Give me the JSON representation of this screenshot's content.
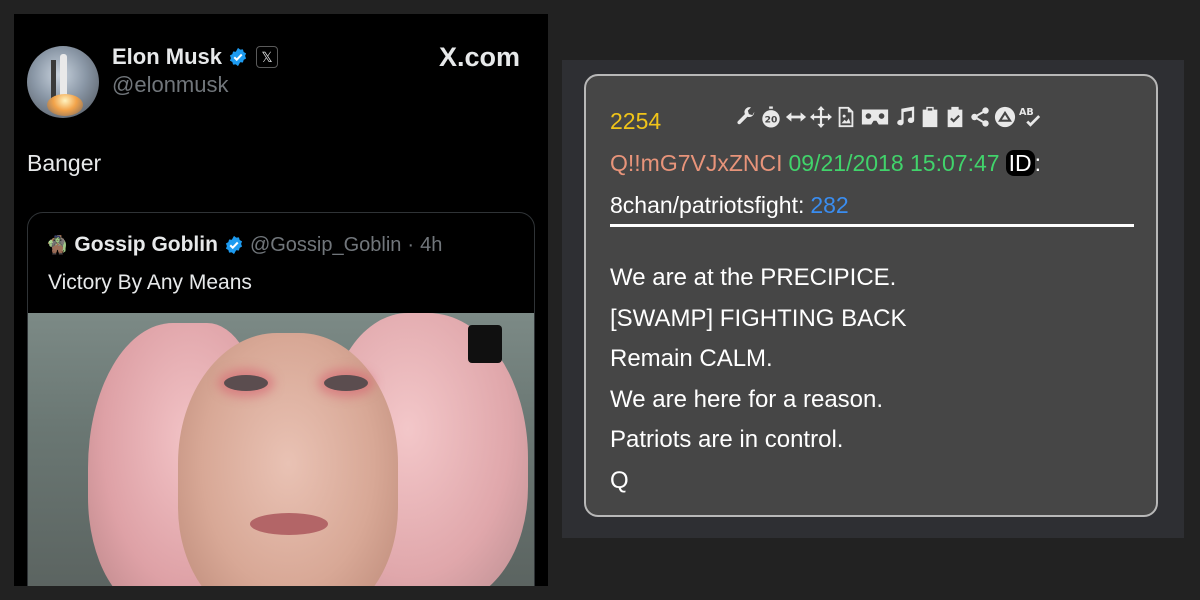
{
  "tweet": {
    "display_name": "Elon Musk",
    "handle": "@elonmusk",
    "site_label": "X.com",
    "x_badge": "𝕏",
    "text": "Banger",
    "colors": {
      "background": "#000000",
      "text": "#e7e9ea",
      "muted": "#71767b",
      "verified": "#1d9bf0"
    },
    "quote": {
      "avatar_emoji": "🧌",
      "display_name": "Gossip Goblin",
      "handle": "@Gossip_Goblin",
      "separator": "·",
      "time": "4h",
      "text": "Victory By Any Means"
    }
  },
  "post": {
    "number": "2254",
    "tripcode": "Q!!mG7VJxZNCI",
    "datetime": "09/21/2018 15:07:47",
    "id_label": "ID",
    "id_colon": ":",
    "board": "8chan/patriotsfight:",
    "board_number": "282",
    "toolbar_icons": [
      "wrench-icon",
      "timer-20-icon",
      "horizontal-arrows-icon",
      "move-arrows-icon",
      "image-file-icon",
      "vr-headset-icon",
      "music-note-icon",
      "clipboard-icon",
      "clipboard-check-icon",
      "share-icon",
      "chevron-up-circle-icon",
      "spellcheck-icon"
    ],
    "message_lines": [
      "We are at the PRECIPICE.",
      "[SWAMP] FIGHTING BACK",
      "Remain CALM.",
      "We are here for a reason.",
      "Patriots are in control.",
      "Q"
    ],
    "colors": {
      "number": "#f0c419",
      "tripcode": "#e8947a",
      "datetime": "#41d36b",
      "board_number": "#3a8df0",
      "box": "#464646"
    }
  }
}
